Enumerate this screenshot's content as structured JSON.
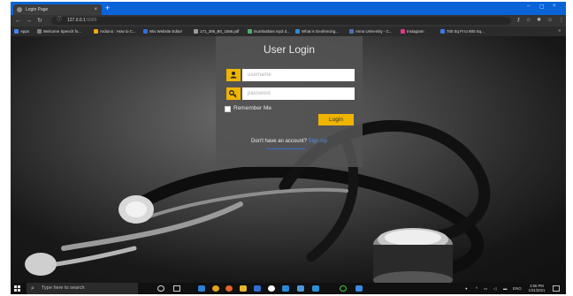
{
  "browser": {
    "tab_title": "Login Page",
    "tab_close": "×",
    "new_tab": "+",
    "window_controls": [
      "–",
      "▢",
      "×"
    ],
    "url_host": "127.0.0.1",
    "url_port": ":5000",
    "toolbar_icons": [
      "key-icon",
      "star-icon",
      "extensions-icon",
      "account-icon",
      "menu-icon"
    ],
    "bookmarks": [
      {
        "label": "Apps",
        "color": "#4285f4"
      },
      {
        "label": "Welcome Speech fo...",
        "color": "#7d7d7d"
      },
      {
        "label": "Arduino : How to C...",
        "color": "#f2a900"
      },
      {
        "label": "Wix Website Editor",
        "color": "#2f6fe0"
      },
      {
        "label": "171_395_B0_1556.pdf",
        "color": "#9a9a9a"
      },
      {
        "label": "inumbutbias mp3 d...",
        "color": "#4db06e"
      },
      {
        "label": "What is Geofencing...",
        "color": "#2a8bd6"
      },
      {
        "label": "Anna University - C...",
        "color": "#4b6fbd"
      },
      {
        "label": "Instagram",
        "color": "#d93b8a"
      },
      {
        "label": "700 Sq Ft to 800 Sq...",
        "color": "#3a7be0"
      }
    ],
    "bookmarks_more": "»"
  },
  "login": {
    "title": "User Login",
    "username_placeholder": "username",
    "password_placeholder": "password",
    "remember_label": "Remember Me",
    "login_button": "Login",
    "no_account_text": "Don't have an account?",
    "signup_link": "Sign Up",
    "accent_color": "#f0b400"
  },
  "taskbar": {
    "search_hint": "Type here to search",
    "time": "4:56 PM",
    "date": "1/31/2021",
    "apps": [
      "cortana-icon",
      "taskview-icon",
      "vscode-icon",
      "chrome-icon",
      "firefox-icon",
      "file-explorer-icon",
      "mail-icon",
      "edge-icon",
      "store-icon",
      "photos-icon",
      "spotify-icon",
      "visual-studio-icon"
    ]
  }
}
